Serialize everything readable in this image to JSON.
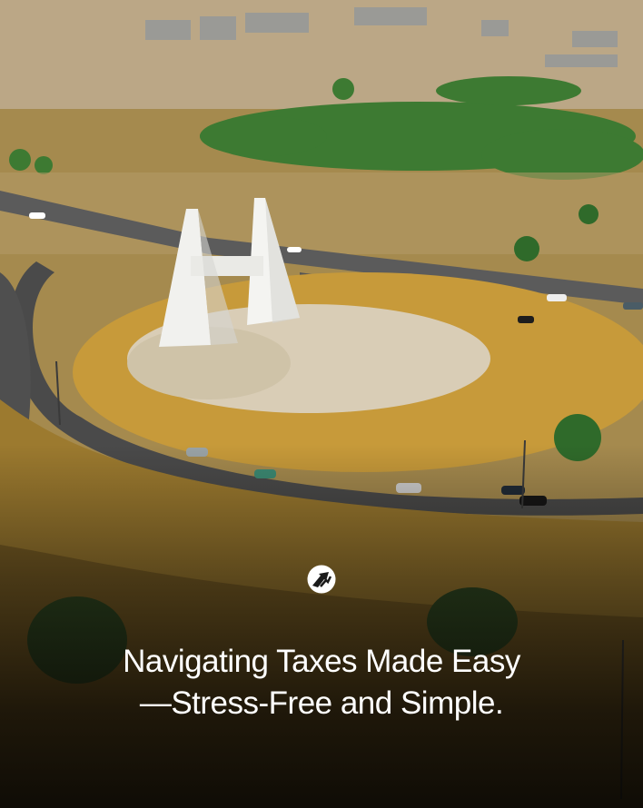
{
  "headline": {
    "line1": "Navigating Taxes Made Easy",
    "line2": "—Stress-Free and Simple."
  },
  "logo": {
    "icon": "road-arrow-logo-icon",
    "color": "#ffffff"
  },
  "colors": {
    "text": "#ffffff",
    "grass": "#b8923a",
    "road": "#4a4a4a",
    "monument": "#f2f2f0",
    "trees": "#2f6a2a"
  }
}
